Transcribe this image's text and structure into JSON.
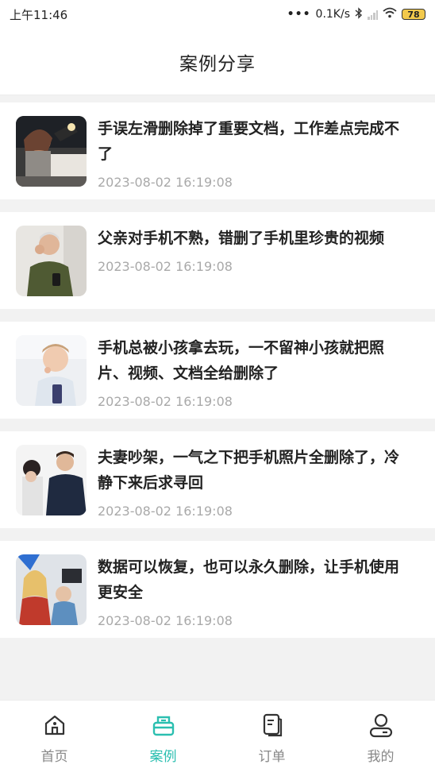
{
  "status_bar": {
    "time": "上午11:46",
    "network_speed": "0.1K/s",
    "battery": "78"
  },
  "header": {
    "title": "案例分享"
  },
  "cases": [
    {
      "title": "手误左滑删除掉了重要文档，工作差点完成不了",
      "time": "2023-08-02 16:19:08"
    },
    {
      "title": "父亲对手机不熟，错删了手机里珍贵的视频",
      "time": "2023-08-02 16:19:08"
    },
    {
      "title": "手机总被小孩拿去玩，一不留神小孩就把照片、视频、文档全给删除了",
      "time": "2023-08-02 16:19:08"
    },
    {
      "title": "夫妻吵架，一气之下把手机照片全删除了，冷静下来后求寻回",
      "time": "2023-08-02 16:19:08"
    },
    {
      "title": "数据可以恢复，也可以永久删除，让手机使用更安全",
      "time": "2023-08-02 16:19:08"
    }
  ],
  "bottom_nav": {
    "items": [
      {
        "label": "首页",
        "icon": "home-icon",
        "active": false
      },
      {
        "label": "案例",
        "icon": "case-icon",
        "active": true
      },
      {
        "label": "订单",
        "icon": "order-icon",
        "active": false
      },
      {
        "label": "我的",
        "icon": "profile-icon",
        "active": false
      }
    ]
  },
  "colors": {
    "accent": "#2bbfb0",
    "inactive": "#888888",
    "timestamp": "#a9a9a9"
  }
}
